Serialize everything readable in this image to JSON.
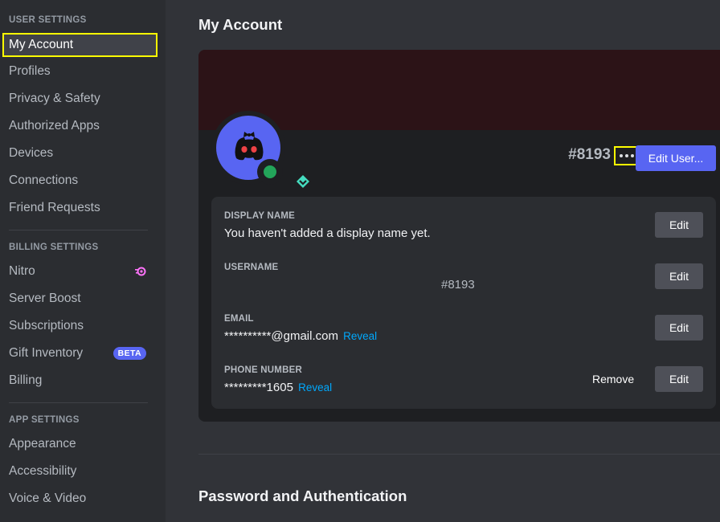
{
  "sidebar": {
    "user_settings_header": "USER SETTINGS",
    "user_items": [
      {
        "label": "My Account",
        "selected": true
      },
      {
        "label": "Profiles"
      },
      {
        "label": "Privacy & Safety"
      },
      {
        "label": "Authorized Apps"
      },
      {
        "label": "Devices"
      },
      {
        "label": "Connections"
      },
      {
        "label": "Friend Requests"
      }
    ],
    "billing_settings_header": "BILLING SETTINGS",
    "billing_items": [
      {
        "label": "Nitro",
        "icon": "nitro-icon"
      },
      {
        "label": "Server Boost"
      },
      {
        "label": "Subscriptions"
      },
      {
        "label": "Gift Inventory",
        "badge": "BETA"
      },
      {
        "label": "Billing"
      }
    ],
    "app_settings_header": "APP SETTINGS",
    "app_items": [
      {
        "label": "Appearance"
      },
      {
        "label": "Accessibility"
      },
      {
        "label": "Voice & Video"
      }
    ]
  },
  "main": {
    "title": "My Account",
    "profile": {
      "tag": "#8193",
      "edit_user_label": "Edit User...",
      "status": "online",
      "colors": {
        "banner": "#2c1317",
        "avatar": "#5865f2",
        "status": "#23a55a"
      }
    },
    "fields": {
      "display_name": {
        "label": "DISPLAY NAME",
        "value": "You haven't added a display name yet.",
        "edit": "Edit"
      },
      "username": {
        "label": "USERNAME",
        "value": "#8193",
        "edit": "Edit"
      },
      "email": {
        "label": "EMAIL",
        "value": "**********@gmail.com",
        "reveal": "Reveal",
        "edit": "Edit"
      },
      "phone": {
        "label": "PHONE NUMBER",
        "value": "*********1605",
        "reveal": "Reveal",
        "remove": "Remove",
        "edit": "Edit"
      }
    },
    "password_section_title": "Password and Authentication"
  }
}
